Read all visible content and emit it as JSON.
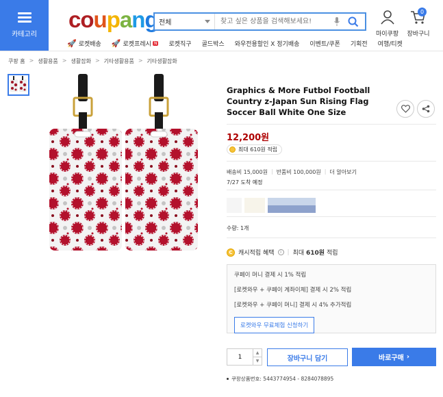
{
  "header": {
    "category_label": "카테고리",
    "logo_text": [
      "c",
      "o",
      "u",
      "p",
      "a",
      "n",
      "g"
    ],
    "logo_colors": [
      "#ae1f23",
      "#ae1f23",
      "#e0541a",
      "#f4b400",
      "#7cb342",
      "#1e9ae6",
      "#1e7be0"
    ],
    "search_scope": "전체",
    "search_placeholder": "찾고 싶은 상품을 검색해보세요!",
    "my_coupang": "마이쿠팡",
    "cart": "장바구니",
    "cart_count": "0"
  },
  "nav": [
    {
      "label": "로켓배송",
      "icon": "rocket-icon"
    },
    {
      "label": "로켓프레시",
      "icon": "rocket-fresh-icon"
    },
    {
      "label": "로켓직구",
      "icon": ""
    },
    {
      "label": "골드박스",
      "icon": ""
    },
    {
      "label": "와우전용할인 X 정기배송",
      "icon": ""
    },
    {
      "label": "이벤트/쿠폰",
      "icon": ""
    },
    {
      "label": "기획전",
      "icon": ""
    },
    {
      "label": "여행/티켓",
      "icon": ""
    }
  ],
  "breadcrumb": [
    "쿠팡 홈",
    "생활용품",
    "생활잡화",
    "기타생활용품",
    "기타생활잡화"
  ],
  "product": {
    "title": "Graphics & More Futbol Football Country z-Japan Sun Rising Flag Soccer Ball White One Size",
    "price": "12,200원",
    "reward": "최대 610원 적립",
    "ship_fee": "배송비 15,000원",
    "return_fee": "반품비 100,000원",
    "more": "더 알아보기",
    "arrival": "7/27 도착 예정",
    "quantity_label": "수량: 1개",
    "cash_label": "캐시적립 혜택",
    "cash_reward_prefix": "최대 ",
    "cash_reward_amount": "610원",
    "cash_reward_suffix": " 적립",
    "benefits": [
      "쿠페이 머니 결제 시 1% 적립",
      "[로켓와우 + 쿠페이 계좌이체] 결제 시 2% 적립",
      "[로켓와우 + 쿠페이 머니] 결제 시 4% 추가적립"
    ],
    "wow_apply": "로켓와우 무료체험 신청하기",
    "quantity": "1",
    "add_to_cart": "장바구니 담기",
    "buy_now": "바로구매",
    "product_id": "쿠팡상품번호: 5443774954 - 8284078895"
  },
  "colors": {
    "accent": "#3a7be8",
    "price": "#ae0000"
  }
}
